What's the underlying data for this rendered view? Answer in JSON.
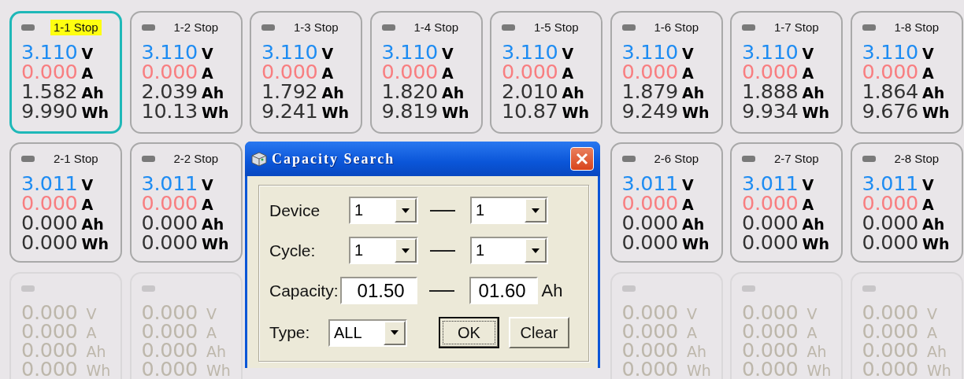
{
  "channels_row_1": [
    {
      "label": "1-1 Stop",
      "selected": true,
      "enabled": true,
      "readings": [
        {
          "kind": "voltage",
          "value": "3.110",
          "unit": "V"
        },
        {
          "kind": "current",
          "value": "0.000",
          "unit": "A"
        },
        {
          "kind": "capacity",
          "value": "1.582",
          "unit": "Ah"
        },
        {
          "kind": "energy",
          "value": "9.990",
          "unit": "Wh"
        }
      ]
    },
    {
      "label": "1-2 Stop",
      "selected": false,
      "enabled": true,
      "readings": [
        {
          "kind": "voltage",
          "value": "3.110",
          "unit": "V"
        },
        {
          "kind": "current",
          "value": "0.000",
          "unit": "A"
        },
        {
          "kind": "capacity",
          "value": "2.039",
          "unit": "Ah"
        },
        {
          "kind": "energy",
          "value": "10.13",
          "unit": "Wh"
        }
      ]
    },
    {
      "label": "1-3 Stop",
      "selected": false,
      "enabled": true,
      "readings": [
        {
          "kind": "voltage",
          "value": "3.110",
          "unit": "V"
        },
        {
          "kind": "current",
          "value": "0.000",
          "unit": "A"
        },
        {
          "kind": "capacity",
          "value": "1.792",
          "unit": "Ah"
        },
        {
          "kind": "energy",
          "value": "9.241",
          "unit": "Wh"
        }
      ]
    },
    {
      "label": "1-4 Stop",
      "selected": false,
      "enabled": true,
      "readings": [
        {
          "kind": "voltage",
          "value": "3.110",
          "unit": "V"
        },
        {
          "kind": "current",
          "value": "0.000",
          "unit": "A"
        },
        {
          "kind": "capacity",
          "value": "1.820",
          "unit": "Ah"
        },
        {
          "kind": "energy",
          "value": "9.819",
          "unit": "Wh"
        }
      ]
    },
    {
      "label": "1-5 Stop",
      "selected": false,
      "enabled": true,
      "readings": [
        {
          "kind": "voltage",
          "value": "3.110",
          "unit": "V"
        },
        {
          "kind": "current",
          "value": "0.000",
          "unit": "A"
        },
        {
          "kind": "capacity",
          "value": "2.010",
          "unit": "Ah"
        },
        {
          "kind": "energy",
          "value": "10.87",
          "unit": "Wh"
        }
      ]
    },
    {
      "label": "1-6 Stop",
      "selected": false,
      "enabled": true,
      "readings": [
        {
          "kind": "voltage",
          "value": "3.110",
          "unit": "V"
        },
        {
          "kind": "current",
          "value": "0.000",
          "unit": "A"
        },
        {
          "kind": "capacity",
          "value": "1.879",
          "unit": "Ah"
        },
        {
          "kind": "energy",
          "value": "9.249",
          "unit": "Wh"
        }
      ]
    },
    {
      "label": "1-7 Stop",
      "selected": false,
      "enabled": true,
      "readings": [
        {
          "kind": "voltage",
          "value": "3.110",
          "unit": "V"
        },
        {
          "kind": "current",
          "value": "0.000",
          "unit": "A"
        },
        {
          "kind": "capacity",
          "value": "1.888",
          "unit": "Ah"
        },
        {
          "kind": "energy",
          "value": "9.934",
          "unit": "Wh"
        }
      ]
    },
    {
      "label": "1-8 Stop",
      "selected": false,
      "enabled": true,
      "readings": [
        {
          "kind": "voltage",
          "value": "3.110",
          "unit": "V"
        },
        {
          "kind": "current",
          "value": "0.000",
          "unit": "A"
        },
        {
          "kind": "capacity",
          "value": "1.864",
          "unit": "Ah"
        },
        {
          "kind": "energy",
          "value": "9.676",
          "unit": "Wh"
        }
      ]
    }
  ],
  "channels_left": [
    {
      "label": "2-1 Stop",
      "selected": false,
      "enabled": true,
      "readings": [
        {
          "kind": "voltage",
          "value": "3.011",
          "unit": "V"
        },
        {
          "kind": "current",
          "value": "0.000",
          "unit": "A"
        },
        {
          "kind": "capacity",
          "value": "0.000",
          "unit": "Ah"
        },
        {
          "kind": "energy",
          "value": "0.000",
          "unit": "Wh"
        }
      ]
    },
    {
      "label": "2-2 Stop",
      "selected": false,
      "enabled": true,
      "readings": [
        {
          "kind": "voltage",
          "value": "3.011",
          "unit": "V"
        },
        {
          "kind": "current",
          "value": "0.000",
          "unit": "A"
        },
        {
          "kind": "capacity",
          "value": "0.000",
          "unit": "Ah"
        },
        {
          "kind": "energy",
          "value": "0.000",
          "unit": "Wh"
        }
      ]
    },
    {
      "selected": false,
      "enabled": false,
      "readings": [
        {
          "kind": "voltage",
          "value": "0.000",
          "unit": "V"
        },
        {
          "kind": "current",
          "value": "0.000",
          "unit": "A"
        },
        {
          "kind": "capacity",
          "value": "0.000",
          "unit": "Ah"
        },
        {
          "kind": "energy",
          "value": "0.000",
          "unit": "Wh"
        }
      ]
    },
    {
      "selected": false,
      "enabled": false,
      "readings": [
        {
          "kind": "voltage",
          "value": "0.000",
          "unit": "V"
        },
        {
          "kind": "current",
          "value": "0.000",
          "unit": "A"
        },
        {
          "kind": "capacity",
          "value": "0.000",
          "unit": "Ah"
        },
        {
          "kind": "energy",
          "value": "0.000",
          "unit": "Wh"
        }
      ]
    }
  ],
  "dialog": {
    "title": "Capacity Search",
    "device": {
      "label": "Device",
      "from": "1",
      "to": "1"
    },
    "cycle": {
      "label": "Cycle:",
      "from": "1",
      "to": "1"
    },
    "capacity": {
      "label": "Capacity:",
      "from": "01.50",
      "to": "01.60",
      "unit": "Ah"
    },
    "type": {
      "label": "Type:",
      "value": "ALL"
    },
    "buttons": [
      {
        "label": "OK",
        "focused": true
      },
      {
        "label": "Clear",
        "focused": false
      }
    ]
  },
  "channels_right": [
    {
      "label": "2-6 Stop",
      "selected": false,
      "enabled": true,
      "readings": [
        {
          "kind": "voltage",
          "value": "3.011",
          "unit": "V"
        },
        {
          "kind": "current",
          "value": "0.000",
          "unit": "A"
        },
        {
          "kind": "capacity",
          "value": "0.000",
          "unit": "Ah"
        },
        {
          "kind": "energy",
          "value": "0.000",
          "unit": "Wh"
        }
      ]
    },
    {
      "label": "2-7 Stop",
      "selected": false,
      "enabled": true,
      "readings": [
        {
          "kind": "voltage",
          "value": "3.011",
          "unit": "V"
        },
        {
          "kind": "current",
          "value": "0.000",
          "unit": "A"
        },
        {
          "kind": "capacity",
          "value": "0.000",
          "unit": "Ah"
        },
        {
          "kind": "energy",
          "value": "0.000",
          "unit": "Wh"
        }
      ]
    },
    {
      "label": "2-8 Stop",
      "selected": false,
      "enabled": true,
      "readings": [
        {
          "kind": "voltage",
          "value": "3.011",
          "unit": "V"
        },
        {
          "kind": "current",
          "value": "0.000",
          "unit": "A"
        },
        {
          "kind": "capacity",
          "value": "0.000",
          "unit": "Ah"
        },
        {
          "kind": "energy",
          "value": "0.000",
          "unit": "Wh"
        }
      ]
    },
    {
      "selected": false,
      "enabled": false,
      "readings": [
        {
          "kind": "voltage",
          "value": "0.000",
          "unit": "V"
        },
        {
          "kind": "current",
          "value": "0.000",
          "unit": "A"
        },
        {
          "kind": "capacity",
          "value": "0.000",
          "unit": "Ah"
        },
        {
          "kind": "energy",
          "value": "0.000",
          "unit": "Wh"
        }
      ]
    },
    {
      "selected": false,
      "enabled": false,
      "readings": [
        {
          "kind": "voltage",
          "value": "0.000",
          "unit": "V"
        },
        {
          "kind": "current",
          "value": "0.000",
          "unit": "A"
        },
        {
          "kind": "capacity",
          "value": "0.000",
          "unit": "Ah"
        },
        {
          "kind": "energy",
          "value": "0.000",
          "unit": "Wh"
        }
      ]
    },
    {
      "selected": false,
      "enabled": false,
      "readings": [
        {
          "kind": "voltage",
          "value": "0.000",
          "unit": "V"
        },
        {
          "kind": "current",
          "value": "0.000",
          "unit": "A"
        },
        {
          "kind": "capacity",
          "value": "0.000",
          "unit": "Ah"
        },
        {
          "kind": "energy",
          "value": "0.000",
          "unit": "Wh"
        }
      ]
    }
  ]
}
